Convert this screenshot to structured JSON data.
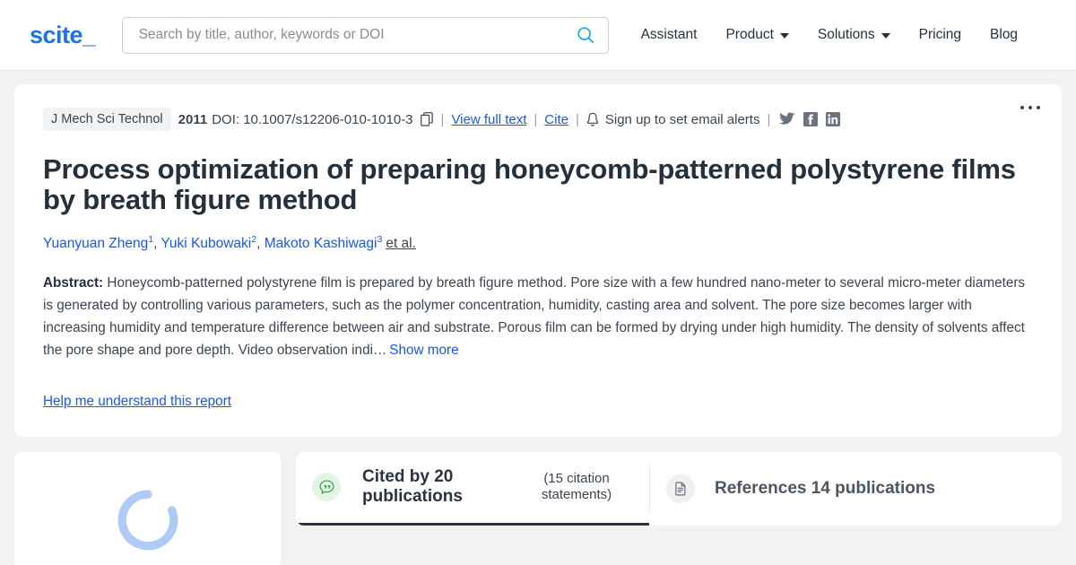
{
  "header": {
    "logo": "scite_",
    "search": {
      "placeholder": "Search by title, author, keywords or DOI",
      "value": "",
      "icon": "search-icon"
    },
    "nav": [
      {
        "label": "Assistant",
        "has_chevron": false
      },
      {
        "label": "Product",
        "has_chevron": true
      },
      {
        "label": "Solutions",
        "has_chevron": true
      },
      {
        "label": "Pricing",
        "has_chevron": false
      },
      {
        "label": "Blog",
        "has_chevron": false
      }
    ]
  },
  "article": {
    "journal": "J Mech Sci Technol",
    "year": "2011",
    "doi": "DOI: 10.1007/s12206-010-1010-3",
    "copy_icon": "copy-icon",
    "view_full_text": "View full text",
    "cite": "Cite",
    "alerts_text": "Sign up to set email alerts",
    "bell_icon": "bell-icon",
    "separator": "|",
    "socials": [
      {
        "name": "twitter-icon"
      },
      {
        "name": "facebook-icon"
      },
      {
        "name": "linkedin-icon"
      }
    ],
    "more_menu": "more-options-icon",
    "title": "Process optimization of preparing honeycomb-patterned polystyrene films by breath figure method",
    "authors": [
      {
        "name": "Yuanyuan Zheng",
        "sup": "1"
      },
      {
        "name": "Yuki Kubowaki",
        "sup": "2"
      },
      {
        "name": "Makoto Kashiwagi",
        "sup": "3"
      }
    ],
    "et_al": "et al.",
    "abstract_label": "Abstract:",
    "abstract_text": "Honeycomb-patterned polystyrene film is prepared by breath figure method. Pore size with a few hundred nano-meter to several micro-meter diameters is generated by controlling various parameters, such as the polymer concentration, humidity, casting area and solvent. The pore size becomes larger with increasing humidity and temperature difference between air and substrate. Porous film can be formed by drying under high humidity. The density of solvents affect the pore shape and pore depth. Video observation indi…",
    "show_more": "Show more",
    "help_link": "Help me understand this report"
  },
  "bottom": {
    "loading_spinner": "loading-spinner",
    "tabs": [
      {
        "icon": "citation-bubble-icon",
        "label": "Cited by 20 publications",
        "sub": "(15 citation statements)",
        "active": true
      },
      {
        "icon": "document-icon",
        "label": "References 14 publications",
        "sub": "",
        "active": false
      }
    ]
  },
  "colors": {
    "brand_blue": "#1a73e8",
    "link_blue": "#1a56f0",
    "search_icon_blue": "#12a5f4",
    "page_bg": "#f2f2f2",
    "card_bg": "#ffffff",
    "text_dark": "#26303b",
    "text_body": "#3c4450",
    "badge_green": "#e4f5e6",
    "icon_green": "#2f9e44",
    "spinner_blue": "#aecbf7",
    "tab_underline": "#2b3340"
  }
}
